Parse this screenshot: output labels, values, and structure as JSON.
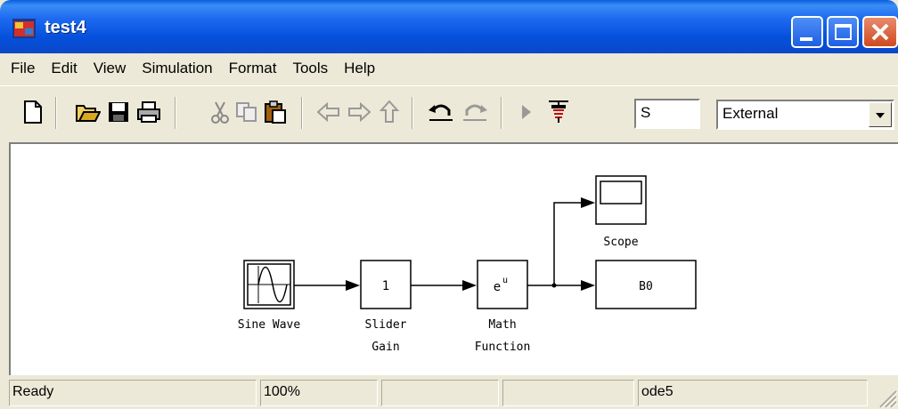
{
  "window": {
    "title": "test4"
  },
  "menu": [
    "File",
    "Edit",
    "View",
    "Simulation",
    "Format",
    "Tools",
    "Help"
  ],
  "toolbar": {
    "buttons": [
      "new-icon",
      "open-icon",
      "save-icon",
      "print-icon",
      "cut-icon",
      "copy-icon",
      "paste-icon",
      "back-icon",
      "forward-icon",
      "up-icon",
      "undo-icon",
      "redo-icon",
      "start-simulation-icon",
      "build-icon"
    ],
    "stop_time": "S",
    "mode": "External"
  },
  "diagram": {
    "blocks": {
      "sine_wave": {
        "label": "Sine Wave"
      },
      "slider_gain": {
        "value": "1",
        "label_line1": "Slider",
        "label_line2": "Gain"
      },
      "math_function": {
        "base": "e",
        "exponent": "u",
        "label_line1": "Math",
        "label_line2": "Function"
      },
      "scope": {
        "label": "Scope"
      },
      "b0": {
        "text": "B0"
      }
    }
  },
  "status": {
    "state": "Ready",
    "zoom": "100%",
    "cell3": "",
    "cell4": "",
    "solver": "ode5"
  }
}
